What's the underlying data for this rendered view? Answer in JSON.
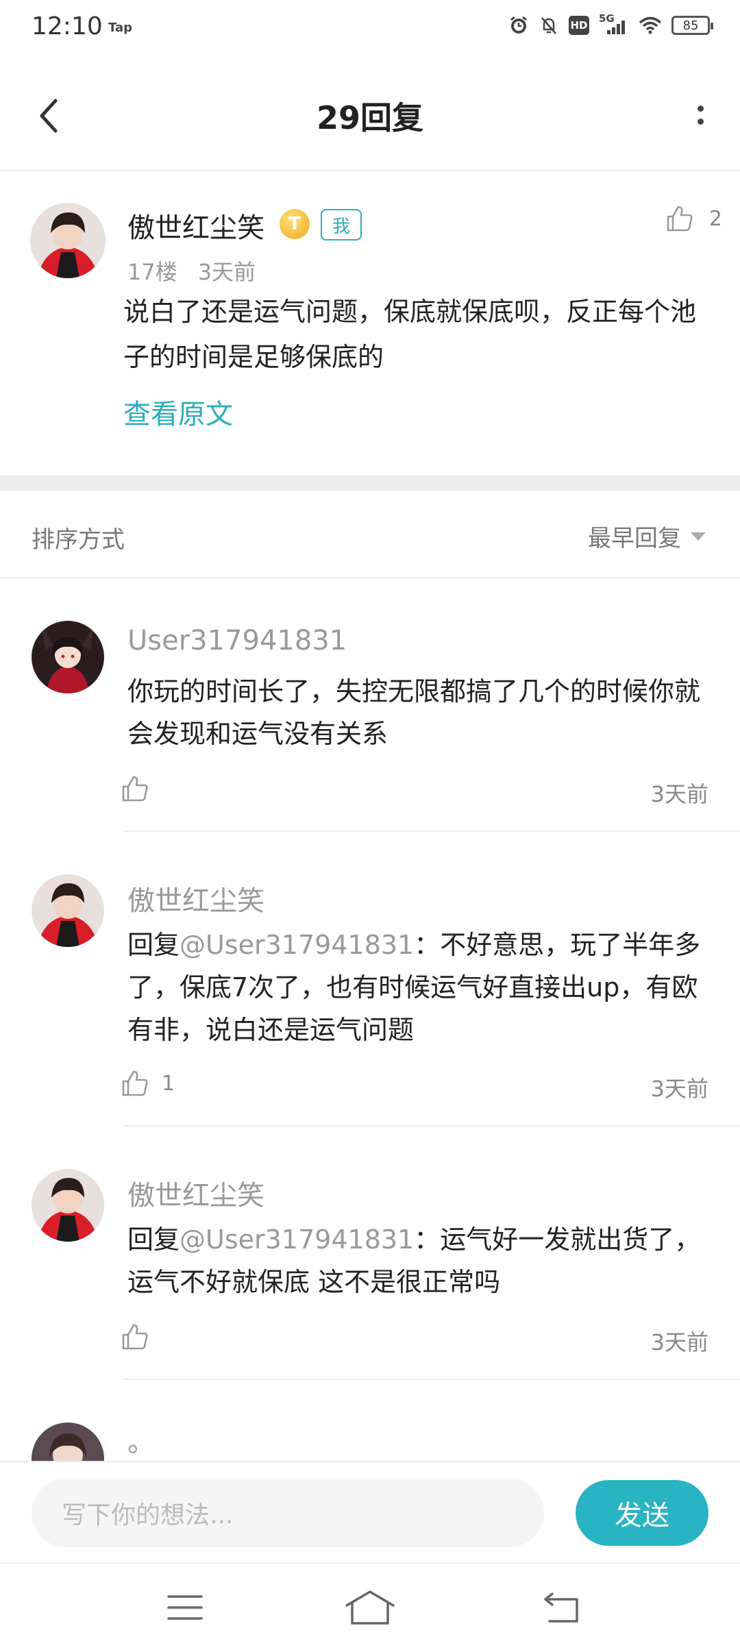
{
  "status_bar": {
    "time": "12:10",
    "tap": "Tap",
    "hd": "HD",
    "network": "5G",
    "battery": "85",
    "icons": [
      "alarm-icon",
      "mute-bell-icon",
      "hd-icon",
      "signal-icon",
      "wifi-icon",
      "battery-icon"
    ]
  },
  "header": {
    "title": "29回复",
    "back_icon": "chevron-left-icon",
    "more_icon": "more-vertical-icon"
  },
  "main_post": {
    "author": "傲世红尘笑",
    "level_badge": "T",
    "me_badge": "我",
    "like_count": "2",
    "floor": "17楼",
    "time": "3天前",
    "text": "说白了还是运气问题，保底就保底呗，反正每个池子的时间是足够保底的",
    "view_original": "查看原文"
  },
  "sort": {
    "label": "排序方式",
    "selected": "最早回复"
  },
  "replies": [
    {
      "author": "User317941831",
      "text": "你玩的时间长了，失控无限都搞了几个的时候你就会发现和运气没有关系",
      "likes": "",
      "time": "3天前"
    },
    {
      "author": "傲世红尘笑",
      "prefix": "回复",
      "mention": "@User317941831",
      "text": "：不好意思，玩了半年多了，保底7次了，也有时候运气好直接出up，有欧有非，说白还是运气问题",
      "likes": "1",
      "time": "3天前"
    },
    {
      "author": "傲世红尘笑",
      "prefix": "回复",
      "mention": "@User317941831",
      "text": "：运气好一发就出货了，运气不好就保底 这不是很正常吗",
      "likes": "",
      "time": "3天前"
    },
    {
      "author": "。"
    }
  ],
  "composer": {
    "placeholder": "写下你的想法...",
    "send_label": "发送"
  },
  "colors": {
    "accent": "#2aaebb",
    "send_button": "#28b4c2",
    "secondary_text": "#999999",
    "divider": "#ececec"
  }
}
